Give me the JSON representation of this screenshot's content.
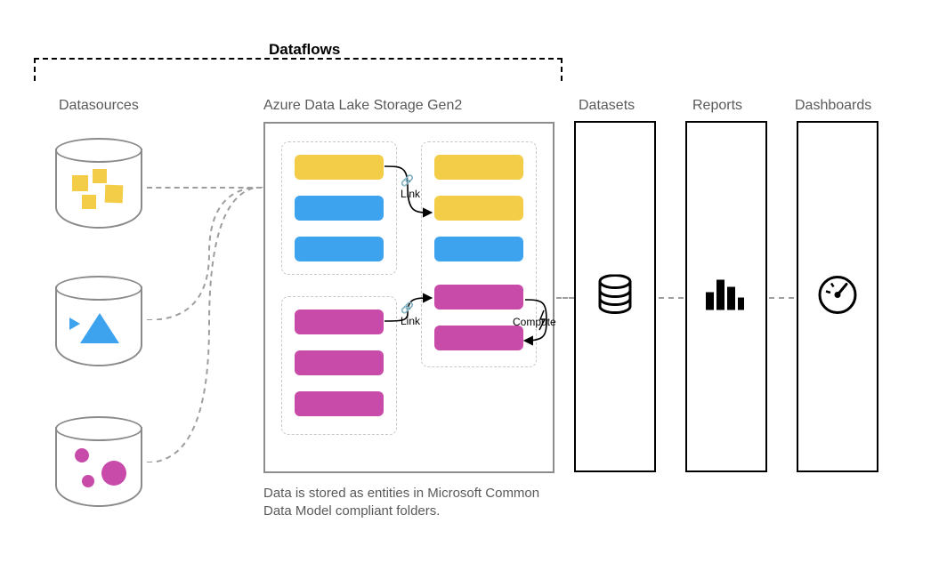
{
  "title": "Dataflows",
  "sections": {
    "datasources": "Datasources",
    "adls": "Azure Data Lake Storage Gen2",
    "datasets": "Datasets",
    "reports": "Reports",
    "dashboards": "Dashboards"
  },
  "link_labels": {
    "link1": "Link",
    "link2": "Link",
    "compute": "Compute"
  },
  "caption": "Data is stored as entities in Microsoft Common Data Model compliant folders.",
  "datasource_shapes": [
    {
      "type": "squares",
      "color": "#f4cd48"
    },
    {
      "type": "triangles",
      "color": "#3ea3ef"
    },
    {
      "type": "circles",
      "color": "#c94ba9"
    }
  ],
  "adls_entities": {
    "group_tl": [
      "yellow",
      "blue",
      "blue"
    ],
    "group_bl": [
      "magenta",
      "magenta",
      "magenta"
    ],
    "group_r": [
      "yellow",
      "yellow",
      "blue",
      "magenta",
      "magenta"
    ]
  },
  "colors": {
    "yellow": "#f4cd48",
    "blue": "#3ea3ef",
    "magenta": "#c94ba9"
  }
}
